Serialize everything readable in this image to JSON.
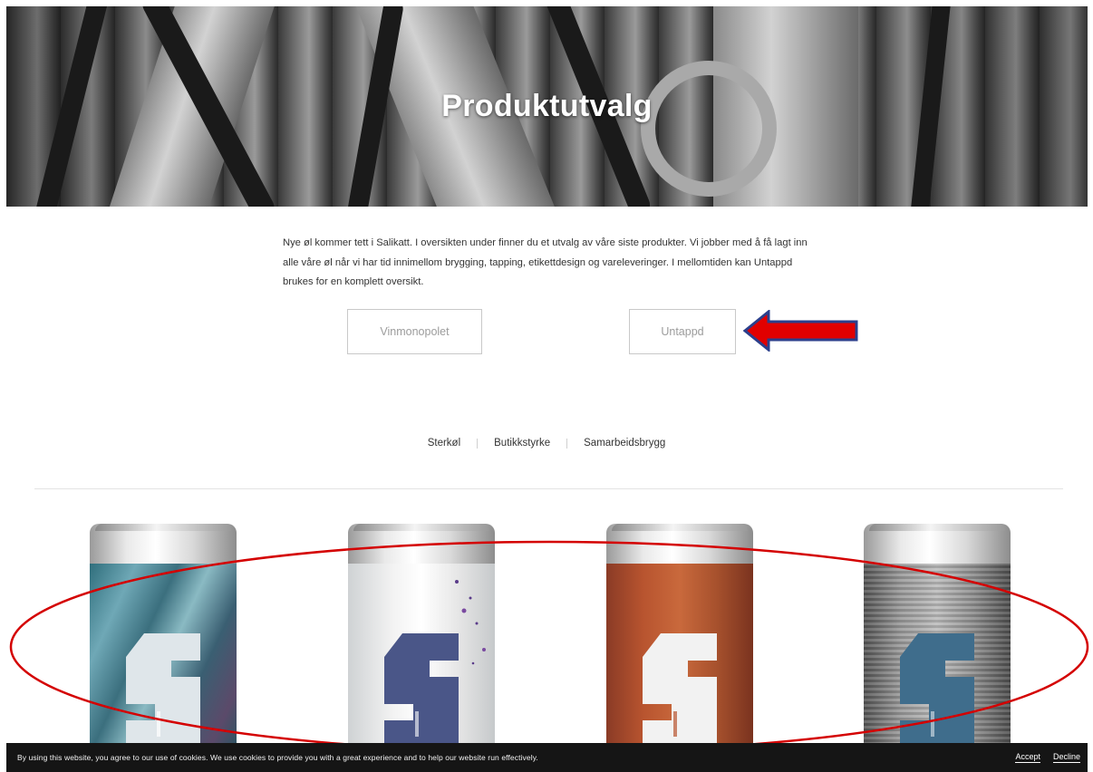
{
  "hero": {
    "title": "Produktutvalg"
  },
  "intro": {
    "text": "Nye øl kommer tett i Salikatt. I oversikten under finner du et utvalg av våre siste produkter. Vi jobber med å få lagt inn alle våre øl når vi har tid innimellom brygging, tapping, etikettdesign og vareleveringer. I mellomtiden kan Untappd brukes for en komplett oversikt."
  },
  "buttons": {
    "vinmonopolet": "Vinmonopolet",
    "untappd": "Untappd"
  },
  "filters": [
    {
      "label": "Sterkøl"
    },
    {
      "label": "Butikkstyrke"
    },
    {
      "label": "Samarbeidsbrygg"
    }
  ],
  "products": [
    {
      "logo_color": "#dfe6ea"
    },
    {
      "logo_color": "#4a5688"
    },
    {
      "logo_color": "#f2f2f2"
    },
    {
      "logo_color": "#3f6d8c"
    }
  ],
  "annotations": {
    "arrow_fill": "#e10000",
    "arrow_stroke": "#2b3f8c",
    "oval_stroke": "#d40000"
  },
  "cookie": {
    "text": "By using this website, you agree to our use of cookies. We use cookies to provide you with a great experience and to help our website run effectively.",
    "accept": "Accept",
    "decline": "Decline"
  }
}
